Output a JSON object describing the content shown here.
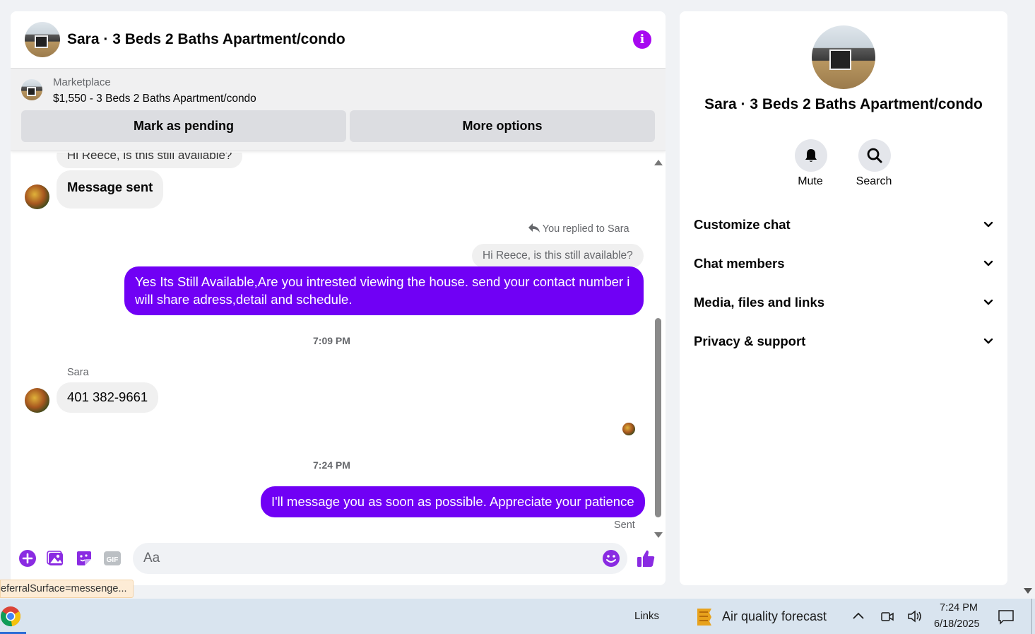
{
  "chat": {
    "title": "Sara · 3 Beds 2 Baths Apartment/condo",
    "marketplace": {
      "label": "Marketplace",
      "item": "$1,550 - 3 Beds 2 Baths Apartment/condo",
      "mark_pending": "Mark as pending",
      "more_options": "More options"
    },
    "messages": {
      "cut_off_text": "Hi Reece, is this still available?",
      "message_sent": "Message sent",
      "replied_label": "You replied to Sara",
      "quoted": "Hi Reece, is this still available?",
      "reply_out": "Yes Its Still Available,Are you intrested viewing the house. send your contact number i will share adress,detail and schedule.",
      "time1": "7:09 PM",
      "sender_name": "Sara",
      "phone": "401 382-9661",
      "time2": "7:24 PM",
      "last_out": "I'll message you as soon as possible. Appreciate your patience",
      "sent_status": "Sent"
    },
    "composer": {
      "placeholder": "Aa",
      "gif_label": "GIF"
    }
  },
  "info_panel": {
    "title": "Sara · 3 Beds 2 Baths Apartment/condo",
    "mute": "Mute",
    "search": "Search",
    "sections": [
      "Customize chat",
      "Chat members",
      "Media, files and links",
      "Privacy & support"
    ]
  },
  "status_url": "eferralSurface=messenge...",
  "taskbar": {
    "links": "Links",
    "weather": "Air quality forecast",
    "time": "7:24 PM",
    "date": "6/18/2025"
  },
  "colors": {
    "accent": "#a707f0",
    "outgoing_bubble": "#7000f5",
    "icon_purple": "#8a2be2"
  }
}
